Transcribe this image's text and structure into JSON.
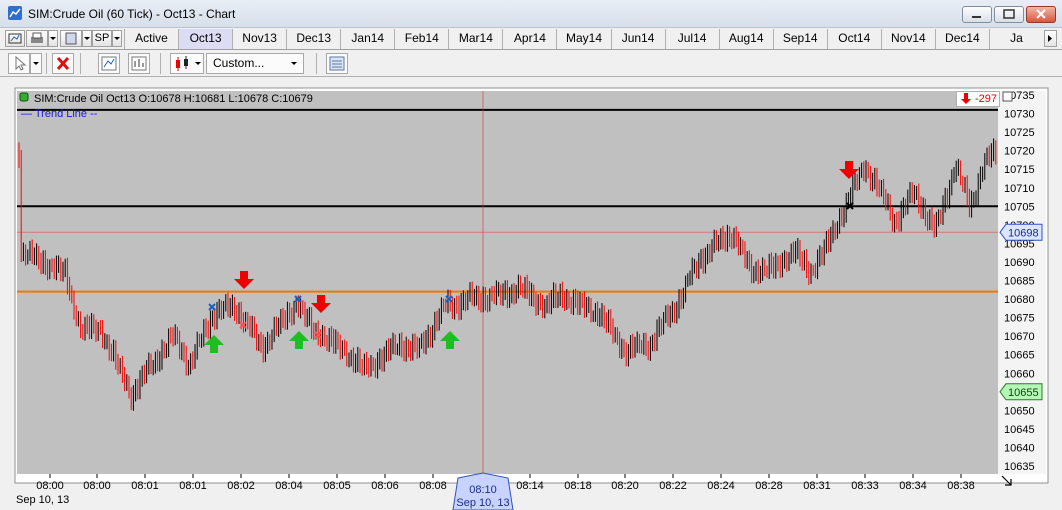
{
  "window": {
    "title": "SIM:Crude Oil (60 Tick) - Oct13 - Chart"
  },
  "toolbar": {
    "instrument_short": "SP",
    "dropdown_value": "Custom...",
    "tabs": [
      "Active",
      "Oct13",
      "Nov13",
      "Dec13",
      "Jan14",
      "Feb14",
      "Mar14",
      "Apr14",
      "May14",
      "Jun14",
      "Jul14",
      "Aug14",
      "Sep14",
      "Oct14",
      "Nov14",
      "Dec14",
      "Ja"
    ],
    "selected_tab": "Oct13"
  },
  "chart": {
    "ohlc_label": "SIM:Crude Oil Oct13 O:10678 H:10681 L:10678 C:10679",
    "trend_label": "Trend Line",
    "pnl": "-297",
    "price_axis": [
      "10735",
      "10730",
      "10725",
      "10720",
      "10715",
      "10710",
      "10705",
      "10700",
      "10695",
      "10690",
      "10685",
      "10680",
      "10675",
      "10670",
      "10665",
      "10660",
      "10655",
      "10650",
      "10645",
      "10640",
      "10635"
    ],
    "current_price_tag": "10698",
    "green_price_tag": "10655",
    "time_axis": [
      "08:00",
      "08:00",
      "08:01",
      "08:01",
      "08:02",
      "08:04",
      "08:05",
      "08:06",
      "08:08",
      "08:10",
      "08:14",
      "08:18",
      "08:20",
      "08:22",
      "08:24",
      "08:28",
      "08:31",
      "08:33",
      "08:34",
      "08:38"
    ],
    "date_label": "Sep 10, 13",
    "crosshair_time": "08:10",
    "crosshair_date": "Sep 10, 13",
    "colors": {
      "plot_bg": "#c0c0c0",
      "up_bar": "#000000",
      "down_bar": "#ff0000",
      "orange_line": "#f07800",
      "crosshair": "#e03030",
      "buy_arrow": "#22bb22",
      "sell_arrow": "#ee0000",
      "price_tag": "#dde6ff",
      "green_tag": "#b8f5b8"
    }
  }
}
